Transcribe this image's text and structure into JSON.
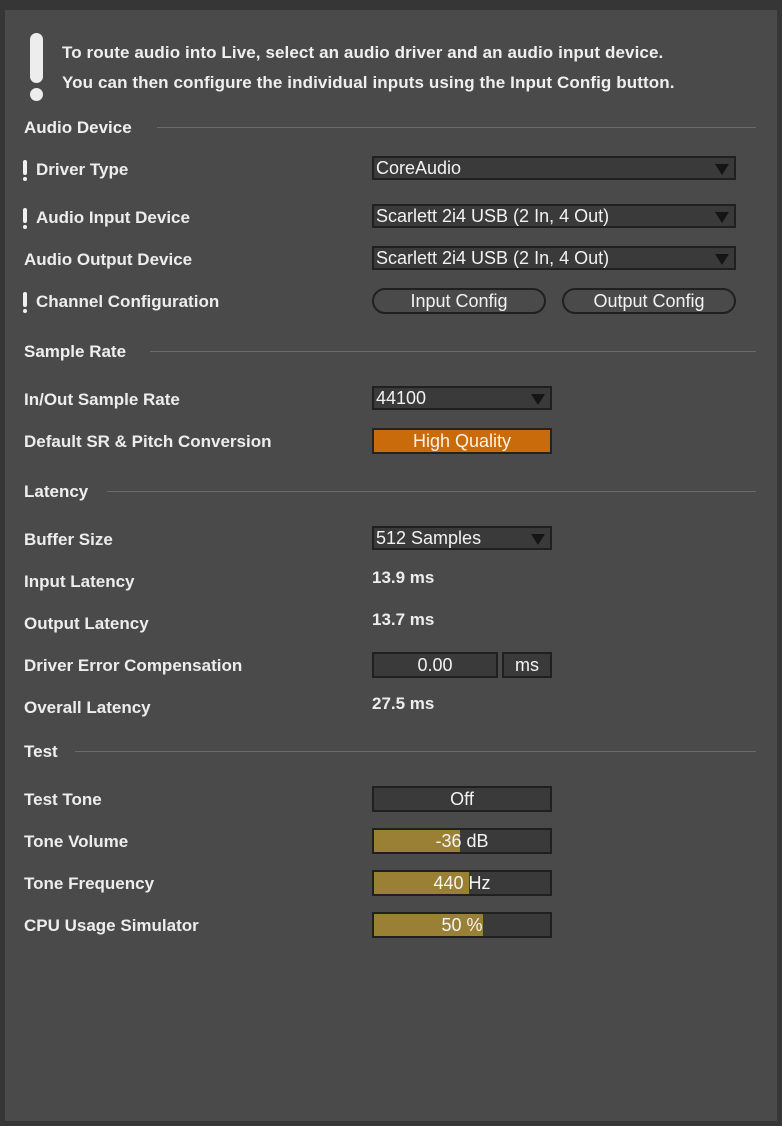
{
  "info": {
    "line1": "To route audio into Live, select an audio driver and an audio input device.",
    "line2": "You can then configure the individual inputs using the Input Config button."
  },
  "sections": {
    "audio_device": "Audio Device",
    "sample_rate": "Sample Rate",
    "latency": "Latency",
    "test": "Test"
  },
  "audio_device": {
    "driver_type": {
      "label": "Driver Type",
      "value": "CoreAudio"
    },
    "input_device": {
      "label": "Audio Input Device",
      "value": "Scarlett 2i4 USB (2 In, 4 Out)"
    },
    "output_device": {
      "label": "Audio Output Device",
      "value": "Scarlett 2i4 USB (2 In, 4 Out)"
    },
    "channel_config": {
      "label": "Channel Configuration",
      "input_button": "Input Config",
      "output_button": "Output Config"
    }
  },
  "sample_rate": {
    "in_out": {
      "label": "In/Out Sample Rate",
      "value": "44100"
    },
    "conversion": {
      "label": "Default SR & Pitch Conversion",
      "value": "High Quality"
    }
  },
  "latency": {
    "buffer_size": {
      "label": "Buffer Size",
      "value": "512 Samples"
    },
    "input_latency": {
      "label": "Input Latency",
      "value": "13.9 ms"
    },
    "output_latency": {
      "label": "Output Latency",
      "value": "13.7 ms"
    },
    "driver_error": {
      "label": "Driver Error Compensation",
      "value": "0.00",
      "unit": "ms"
    },
    "overall": {
      "label": "Overall Latency",
      "value": "27.5 ms"
    }
  },
  "test": {
    "test_tone": {
      "label": "Test Tone",
      "value": "Off"
    },
    "tone_volume": {
      "label": "Tone Volume",
      "value_text": "-36",
      "unit": "dB",
      "fill_fraction": 0.49
    },
    "tone_frequency": {
      "label": "Tone Frequency",
      "value_text": "440",
      "unit": "Hz",
      "fill_fraction": 0.54
    },
    "cpu_simulator": {
      "label": "CPU Usage Simulator",
      "value_text": "50",
      "unit": "%",
      "fill_fraction": 0.62
    }
  },
  "colors": {
    "panel": "#4a4a4a",
    "accent_orange": "#c96a0b",
    "slider_fill": "#9a8034"
  }
}
